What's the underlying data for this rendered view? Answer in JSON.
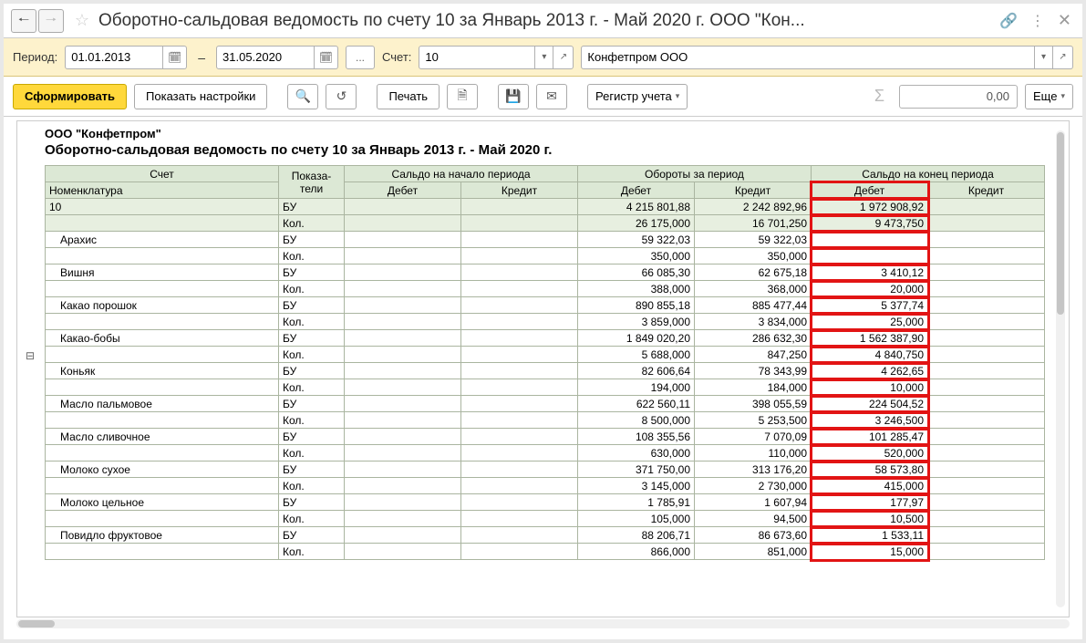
{
  "window": {
    "title": "Оборотно-сальдовая ведомость по счету 10 за Январь 2013 г. - Май 2020 г. ООО \"Кон..."
  },
  "period": {
    "label": "Период:",
    "from": "01.01.2013",
    "to": "31.05.2020",
    "account_label": "Счет:",
    "account": "10",
    "org": "Конфетпром ООО"
  },
  "toolbar": {
    "generate": "Сформировать",
    "show_settings": "Показать настройки",
    "print": "Печать",
    "register": "Регистр учета",
    "more": "Еще",
    "sum": "0,00"
  },
  "report": {
    "company": "ООО \"Конфетпром\"",
    "title": "Оборотно-сальдовая ведомость по счету 10 за Январь 2013 г. - Май 2020 г.",
    "headers": {
      "account": "Счет",
      "nomenclature": "Номенклатура",
      "indicators": "Показа-\nтели",
      "saldo_begin": "Сальдо на начало периода",
      "turnover": "Обороты за период",
      "saldo_end": "Сальдо на конец периода",
      "debit": "Дебет",
      "credit": "Кредит"
    },
    "account_row": {
      "name": "10",
      "ind1": "БУ",
      "turn_d": "4 215 801,88",
      "turn_c": "2 242 892,96",
      "end_d": "1 972 908,92",
      "ind2": "Кол.",
      "turn_d2": "26 175,000",
      "turn_c2": "16 701,250",
      "end_d2": "9 473,750"
    },
    "rows": [
      {
        "name": "Арахис",
        "ind1": "БУ",
        "td": "59 322,03",
        "tc": "59 322,03",
        "ed": "",
        "ind2": "Кол.",
        "td2": "350,000",
        "tc2": "350,000",
        "ed2": ""
      },
      {
        "name": "Вишня",
        "ind1": "БУ",
        "td": "66 085,30",
        "tc": "62 675,18",
        "ed": "3 410,12",
        "ind2": "Кол.",
        "td2": "388,000",
        "tc2": "368,000",
        "ed2": "20,000"
      },
      {
        "name": "Какао порошок",
        "ind1": "БУ",
        "td": "890 855,18",
        "tc": "885 477,44",
        "ed": "5 377,74",
        "ind2": "Кол.",
        "td2": "3 859,000",
        "tc2": "3 834,000",
        "ed2": "25,000"
      },
      {
        "name": "Какао-бобы",
        "ind1": "БУ",
        "td": "1 849 020,20",
        "tc": "286 632,30",
        "ed": "1 562 387,90",
        "ind2": "Кол.",
        "td2": "5 688,000",
        "tc2": "847,250",
        "ed2": "4 840,750"
      },
      {
        "name": "Коньяк",
        "ind1": "БУ",
        "td": "82 606,64",
        "tc": "78 343,99",
        "ed": "4 262,65",
        "ind2": "Кол.",
        "td2": "194,000",
        "tc2": "184,000",
        "ed2": "10,000"
      },
      {
        "name": "Масло пальмовое",
        "ind1": "БУ",
        "td": "622 560,11",
        "tc": "398 055,59",
        "ed": "224 504,52",
        "ind2": "Кол.",
        "td2": "8 500,000",
        "tc2": "5 253,500",
        "ed2": "3 246,500"
      },
      {
        "name": "Масло сливочное",
        "ind1": "БУ",
        "td": "108 355,56",
        "tc": "7 070,09",
        "ed": "101 285,47",
        "ind2": "Кол.",
        "td2": "630,000",
        "tc2": "110,000",
        "ed2": "520,000"
      },
      {
        "name": "Молоко сухое",
        "ind1": "БУ",
        "td": "371 750,00",
        "tc": "313 176,20",
        "ed": "58 573,80",
        "ind2": "Кол.",
        "td2": "3 145,000",
        "tc2": "2 730,000",
        "ed2": "415,000"
      },
      {
        "name": "Молоко цельное",
        "ind1": "БУ",
        "td": "1 785,91",
        "tc": "1 607,94",
        "ed": "177,97",
        "ind2": "Кол.",
        "td2": "105,000",
        "tc2": "94,500",
        "ed2": "10,500"
      },
      {
        "name": "Повидло фруктовое",
        "ind1": "БУ",
        "td": "88 206,71",
        "tc": "86 673,60",
        "ed": "1 533,11",
        "ind2": "Кол.",
        "td2": "866,000",
        "tc2": "851,000",
        "ed2": "15,000"
      }
    ]
  }
}
